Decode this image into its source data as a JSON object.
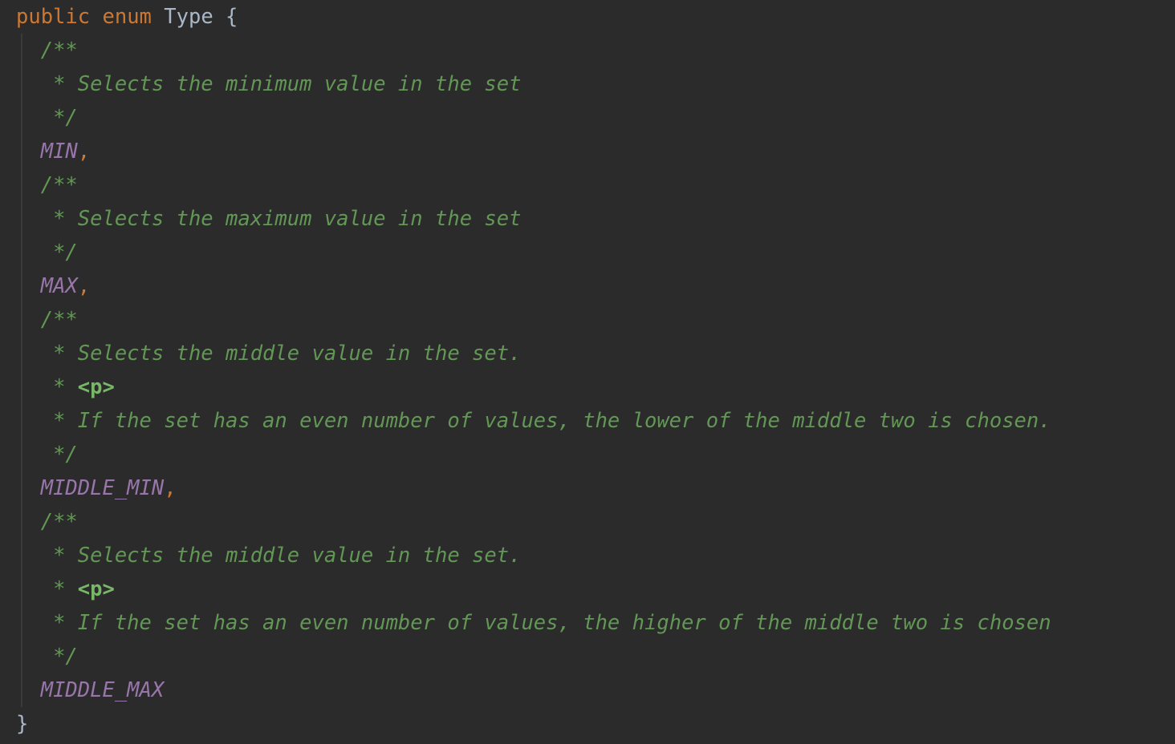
{
  "editor": {
    "colors": {
      "background": "#2B2B2B",
      "keyword": "#CC7832",
      "plain": "#A9B7C6",
      "doc_comment": "#629755",
      "doc_tag": "#77B767",
      "enum_constant": "#9876AA"
    },
    "decl": {
      "kw_public": "public",
      "kw_enum": "enum",
      "type_name": "Type",
      "open_brace": "{",
      "close_brace": "}"
    },
    "entries": [
      {
        "doc_open": "/**",
        "doc_lines": [
          "* Selects the minimum value in the set"
        ],
        "doc_close": "*/",
        "constant": "MIN",
        "separator": ","
      },
      {
        "doc_open": "/**",
        "doc_lines": [
          "* Selects the maximum value in the set"
        ],
        "doc_close": "*/",
        "constant": "MAX",
        "separator": ","
      },
      {
        "doc_open": "/**",
        "doc_lines": [
          "* Selects the middle value in the set.",
          "* ",
          "* If the set has an even number of values, the lower of the middle two is chosen."
        ],
        "doc_tag": "<p>",
        "doc_close": "*/",
        "constant": "MIDDLE_MIN",
        "separator": ","
      },
      {
        "doc_open": "/**",
        "doc_lines": [
          "* Selects the middle value in the set.",
          "* ",
          "* If the set has an even number of values, the higher of the middle two is chosen"
        ],
        "doc_tag": "<p>",
        "doc_close": "*/",
        "constant": "MIDDLE_MAX",
        "separator": ""
      }
    ]
  }
}
